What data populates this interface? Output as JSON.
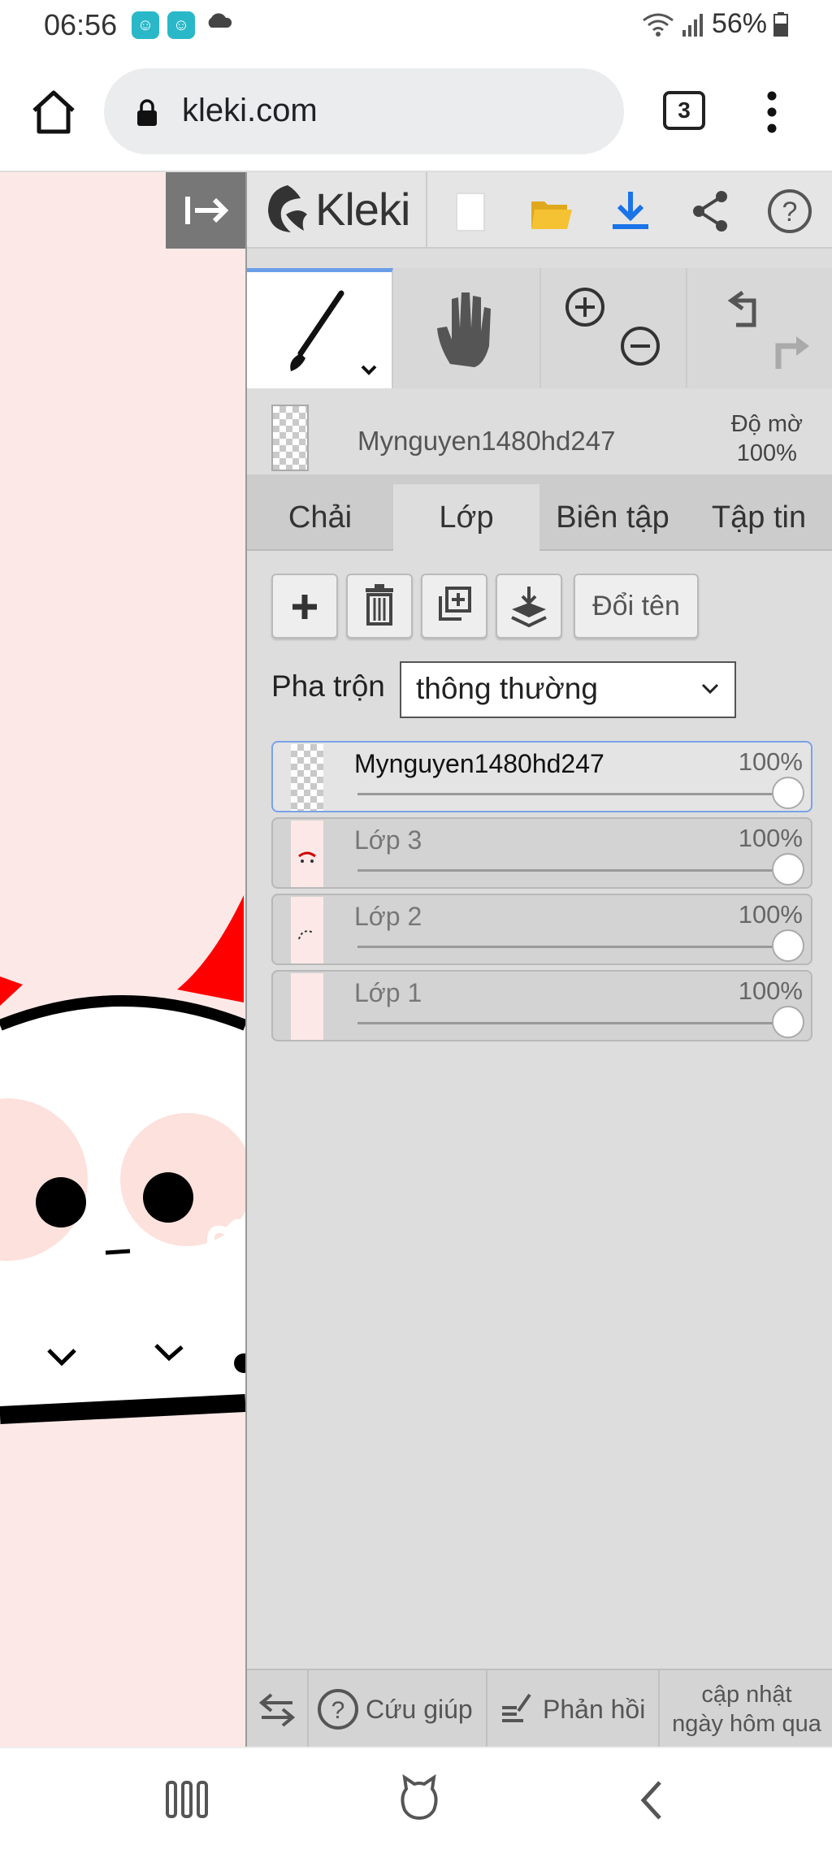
{
  "status_bar": {
    "time": "06:56",
    "battery": "56%"
  },
  "browser": {
    "url": "kleki.com",
    "tab_count": "3"
  },
  "app": {
    "logo_text": "Kleki",
    "current_layer": {
      "name": "Mynguyen1480hd247",
      "opacity_label": "Độ mờ",
      "opacity_value": "100%"
    },
    "tabs": [
      {
        "label": "Chải"
      },
      {
        "label": "Lớp"
      },
      {
        "label": "Biên tập"
      },
      {
        "label": "Tập tin"
      }
    ],
    "rename_button": "Đổi tên",
    "blend": {
      "label": "Pha trộn",
      "value": "thông thường"
    },
    "layers": [
      {
        "name": "Mynguyen1480hd247",
        "opacity": "100%",
        "opacity_value": 1.0,
        "selected": true
      },
      {
        "name": "Lớp 3",
        "opacity": "100%",
        "opacity_value": 1.0,
        "selected": false
      },
      {
        "name": "Lớp 2",
        "opacity": "100%",
        "opacity_value": 1.0,
        "selected": false
      },
      {
        "name": "Lớp 1",
        "opacity": "100%",
        "opacity_value": 1.0,
        "selected": false
      }
    ],
    "footer": {
      "help": "Cứu giúp",
      "feedback": "Phản hồi",
      "update_line1": "cập nhật",
      "update_line2": "ngày hôm qua"
    }
  },
  "colors": {
    "accent_blue": "#1a73e8",
    "canvas_bg": "#fde8e8",
    "devil_red": "#ff0000",
    "folder_yellow": "#f5c234"
  }
}
